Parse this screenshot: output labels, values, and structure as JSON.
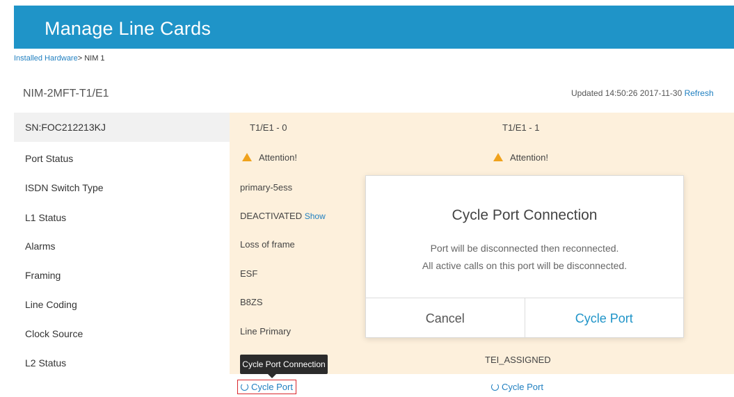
{
  "header": {
    "title": "Manage Line Cards"
  },
  "breadcrumb": {
    "link": "Installed Hardware",
    "separator": ">",
    "current": " NIM 1"
  },
  "device": {
    "name": "NIM-2MFT-T1/E1",
    "updated": "Updated 14:50:26 2017-11-30",
    "refresh_label": "Refresh"
  },
  "sidebar": {
    "serial": "SN:FOC212213KJ",
    "labels": [
      "Port Status",
      "ISDN Switch Type",
      "L1 Status",
      "Alarms",
      "Framing",
      "Line Coding",
      "Clock Source",
      "L2 Status"
    ]
  },
  "ports": [
    {
      "name": "T1/E1 - 0",
      "status": "Attention!",
      "isdn_switch_type": "primary-5ess",
      "l1_status": "DEACTIVATED",
      "l1_show_label": "Show",
      "alarms": "Loss of frame",
      "framing": "ESF",
      "line_coding": "B8ZS",
      "clock_source": "Line Primary",
      "cycle_label": "Cycle Port"
    },
    {
      "name": "T1/E1 - 1",
      "status": "Attention!",
      "l2_status": "TEI_ASSIGNED",
      "cycle_label": "Cycle Port"
    }
  ],
  "tooltip": {
    "text": "Cycle Port Connection"
  },
  "modal": {
    "title": "Cycle Port Connection",
    "line1": "Port will be disconnected then reconnected.",
    "line2": "All active calls on this port will be disconnected.",
    "cancel_label": "Cancel",
    "confirm_label": "Cycle Port"
  },
  "colors": {
    "header": "#1f94c8",
    "link": "#1f7fc0",
    "warning": "#f0a21c",
    "row_bg": "#fdf0dc",
    "highlight": "#d9262c"
  }
}
